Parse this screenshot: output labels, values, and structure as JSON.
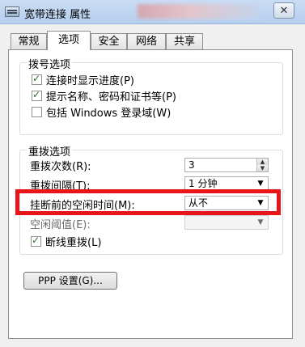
{
  "window": {
    "title": "宽带连接 属性",
    "close_glyph": "✕"
  },
  "tabs": [
    {
      "label": "常规",
      "active": false
    },
    {
      "label": "选项",
      "active": true
    },
    {
      "label": "安全",
      "active": false
    },
    {
      "label": "网络",
      "active": false
    },
    {
      "label": "共享",
      "active": false
    }
  ],
  "dialing_options": {
    "legend": "拨号选项",
    "items": [
      {
        "label": "连接时显示进度(P)",
        "checked": true
      },
      {
        "label": "提示名称、密码和证书等(P)",
        "checked": true
      },
      {
        "label": "包括 Windows 登录域(W)",
        "checked": false
      }
    ]
  },
  "redial_options": {
    "legend": "重拨选项",
    "redial_attempts_label": "重拨次数(R):",
    "redial_attempts_value": "3",
    "redial_interval_label": "重拨间隔(T):",
    "redial_interval_value": "1 分钟",
    "idle_time_label": "挂断前的空闲时间(M):",
    "idle_time_value": "从不",
    "idle_threshold_label": "空闲阈值(E):",
    "idle_threshold_value": "",
    "redial_on_drop_label": "断线重拨(L)",
    "redial_on_drop_checked": true
  },
  "ppp_button_label": "PPP 设置(G)...",
  "highlight_color": "#e8141a"
}
